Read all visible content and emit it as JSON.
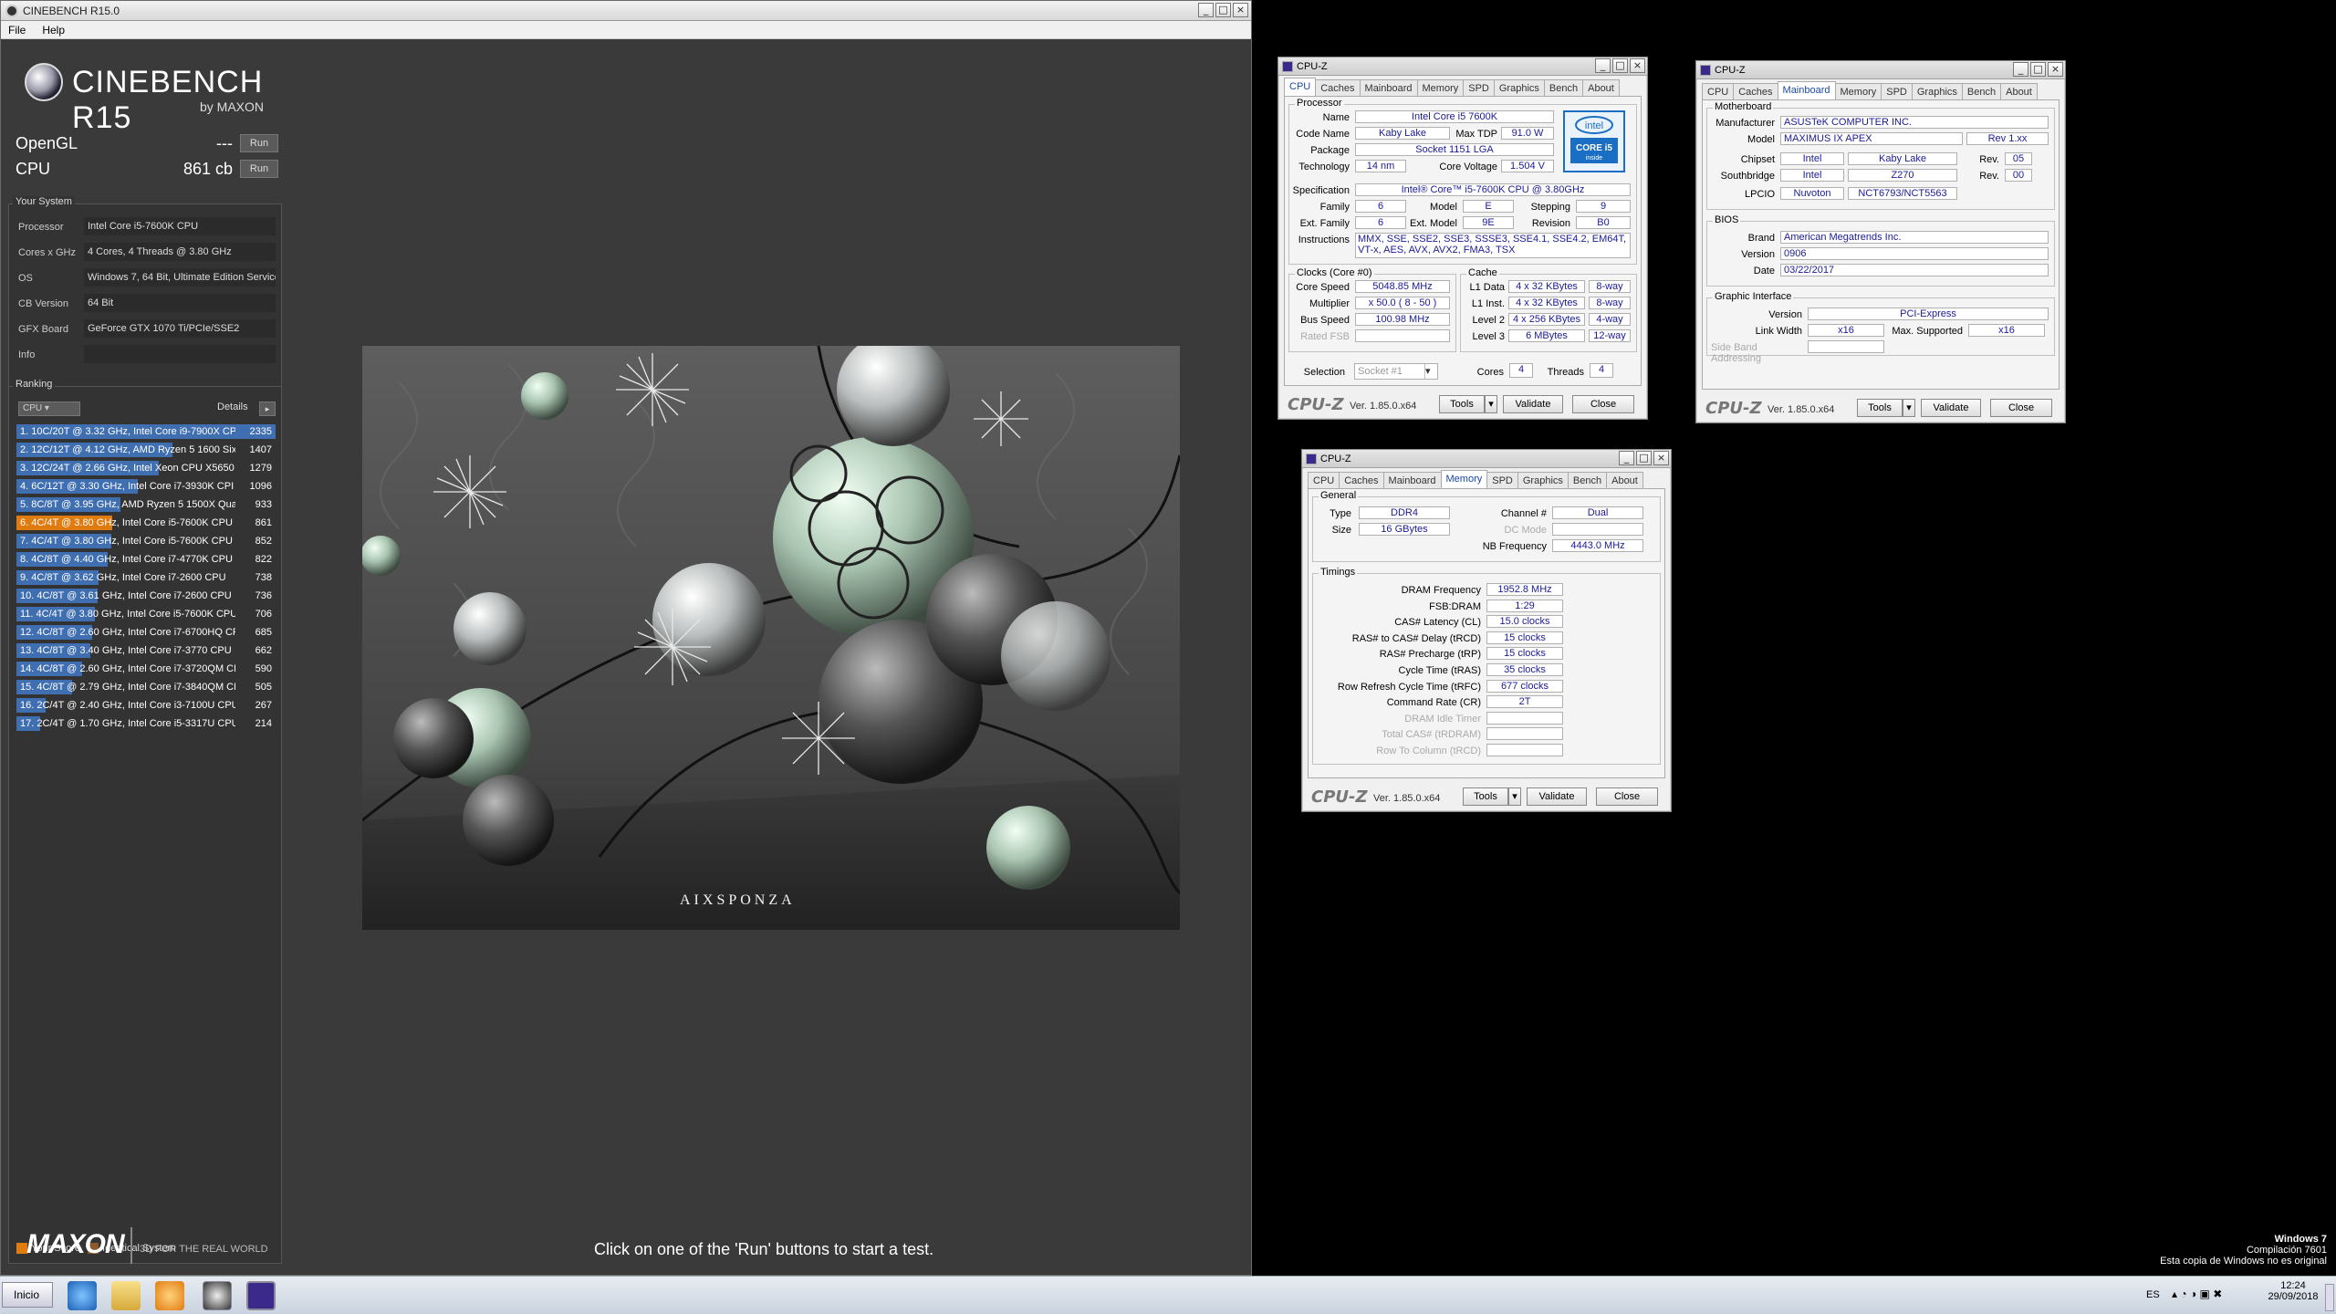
{
  "cinebench": {
    "window_title": "CINEBENCH R15.0",
    "menu": [
      "File",
      "Help"
    ],
    "logo": {
      "title": "CINEBENCH R15",
      "subtitle": "by MAXON"
    },
    "opengl": {
      "label": "OpenGL",
      "value": "---",
      "run": "Run"
    },
    "cpu": {
      "label": "CPU",
      "value": "861 cb",
      "run": "Run"
    },
    "your_system": {
      "title": "Your System",
      "rows": [
        {
          "key": "Processor",
          "value": "Intel Core i5-7600K CPU"
        },
        {
          "key": "Cores x GHz",
          "value": "4 Cores, 4 Threads @ 3.80 GHz"
        },
        {
          "key": "OS",
          "value": "Windows 7, 64 Bit, Ultimate Edition Service"
        },
        {
          "key": "CB Version",
          "value": "64 Bit"
        },
        {
          "key": "GFX Board",
          "value": "GeForce GTX 1070 Ti/PCIe/SSE2"
        },
        {
          "key": "Info",
          "value": ""
        }
      ]
    },
    "ranking": {
      "title": "Ranking",
      "selector": "CPU",
      "details": "Details",
      "rows": [
        {
          "text": "1. 10C/20T @ 3.32 GHz, Intel Core i9-7900X CP",
          "score": "2335",
          "bar": 1.0,
          "mine": false
        },
        {
          "text": "2. 12C/12T @ 4.12 GHz, AMD Ryzen 5 1600 Six",
          "score": "1407",
          "bar": 0.603,
          "mine": false
        },
        {
          "text": "3. 12C/24T @ 2.66 GHz, Intel Xeon CPU X5650",
          "score": "1279",
          "bar": 0.548,
          "mine": false
        },
        {
          "text": "4. 6C/12T @ 3.30 GHz, Intel Core i7-3930K CPI",
          "score": "1096",
          "bar": 0.469,
          "mine": false
        },
        {
          "text": "5. 8C/8T @ 3.95 GHz, AMD Ryzen 5 1500X Quad",
          "score": "933",
          "bar": 0.4,
          "mine": false
        },
        {
          "text": "6. 4C/4T @ 3.80 GHz, Intel Core i5-7600K CPU",
          "score": "861",
          "bar": 0.369,
          "mine": true
        },
        {
          "text": "7. 4C/4T @ 3.80 GHz, Intel Core i5-7600K CPU",
          "score": "852",
          "bar": 0.365,
          "mine": false
        },
        {
          "text": "8. 4C/8T @ 4.40 GHz, Intel Core i7-4770K CPU",
          "score": "822",
          "bar": 0.352,
          "mine": false
        },
        {
          "text": "9. 4C/8T @ 3.62 GHz, Intel Core i7-2600 CPU",
          "score": "738",
          "bar": 0.316,
          "mine": false
        },
        {
          "text": "10. 4C/8T @ 3.61 GHz, Intel Core i7-2600 CPU",
          "score": "736",
          "bar": 0.315,
          "mine": false
        },
        {
          "text": "11. 4C/4T @ 3.80 GHz, Intel Core i5-7600K CPU",
          "score": "706",
          "bar": 0.302,
          "mine": false
        },
        {
          "text": "12. 4C/8T @ 2.60 GHz, Intel Core i7-6700HQ CPI",
          "score": "685",
          "bar": 0.293,
          "mine": false
        },
        {
          "text": "13. 4C/8T @ 3.40 GHz, Intel Core i7-3770 CPU",
          "score": "662",
          "bar": 0.284,
          "mine": false
        },
        {
          "text": "14. 4C/8T @ 2.60 GHz, Intel Core i7-3720QM CPI",
          "score": "590",
          "bar": 0.253,
          "mine": false
        },
        {
          "text": "15. 4C/8T @ 2.79 GHz, Intel Core i7-3840QM CF",
          "score": "505",
          "bar": 0.216,
          "mine": false
        },
        {
          "text": "16. 2C/4T @ 2.40 GHz, Intel Core i3-7100U CPU",
          "score": "267",
          "bar": 0.114,
          "mine": false
        },
        {
          "text": "17. 2C/4T @ 1.70 GHz, Intel Core i5-3317U CPU",
          "score": "214",
          "bar": 0.092,
          "mine": false
        }
      ]
    },
    "legend": {
      "your_score": "Your Score",
      "identical": "Identical System"
    },
    "footer": {
      "brand": "MAXON",
      "tagline": "3D FOR THE REAL WORLD"
    },
    "render_watermark": "AIXSPONZA",
    "message": "Click on one of the 'Run' buttons to start a test."
  },
  "cpuz1": {
    "title": "CPU-Z",
    "tabs": [
      "CPU",
      "Caches",
      "Mainboard",
      "Memory",
      "SPD",
      "Graphics",
      "Bench",
      "About"
    ],
    "active_tab": "CPU",
    "processor_title": "Processor",
    "name_l": "Name",
    "name": "Intel Core i5 7600K",
    "codename_l": "Code Name",
    "codename": "Kaby Lake",
    "maxtdp_l": "Max TDP",
    "maxtdp": "91.0 W",
    "package_l": "Package",
    "package": "Socket 1151 LGA",
    "tech_l": "Technology",
    "tech": "14 nm",
    "voltage_l": "Core Voltage",
    "voltage": "1.504 V",
    "spec_l": "Specification",
    "spec": "Intel® Core™ i5-7600K CPU @ 3.80GHz",
    "family_l": "Family",
    "family": "6",
    "model_l": "Model",
    "model": "E",
    "stepping_l": "Stepping",
    "stepping": "9",
    "extfamily_l": "Ext. Family",
    "extfamily": "6",
    "extmodel_l": "Ext. Model",
    "extmodel": "9E",
    "revision_l": "Revision",
    "revision": "B0",
    "instr_l": "Instructions",
    "instr": "MMX, SSE, SSE2, SSE3, SSSE3, SSE4.1, SSE4.2, EM64T, VT-x, AES, AVX, AVX2, FMA3, TSX",
    "clocks_title": "Clocks (Core #0)",
    "corespeed_l": "Core Speed",
    "corespeed": "5048.85 MHz",
    "mult_l": "Multiplier",
    "mult": "x 50.0 ( 8 - 50 )",
    "bus_l": "Bus Speed",
    "bus": "100.98 MHz",
    "fsb_l": "Rated FSB",
    "fsb": "",
    "cache_title": "Cache",
    "l1d_l": "L1 Data",
    "l1d": "4 x 32 KBytes",
    "l1d_w": "8-way",
    "l1i_l": "L1 Inst.",
    "l1i": "4 x 32 KBytes",
    "l1i_w": "8-way",
    "l2_l": "Level 2",
    "l2": "4 x 256 KBytes",
    "l2_w": "4-way",
    "l3_l": "Level 3",
    "l3": "6 MBytes",
    "l3_w": "12-way",
    "sel_l": "Selection",
    "sel": "Socket #1",
    "cores_l": "Cores",
    "cores": "4",
    "threads_l": "Threads",
    "threads": "4",
    "intel_logo": {
      "brand": "intel",
      "line1": "CORE i5",
      "line2": "inside"
    },
    "logo": "CPU-Z",
    "ver": "Ver. 1.85.0.x64",
    "tools": "Tools",
    "validate": "Validate",
    "close": "Close"
  },
  "cpuz2": {
    "title": "CPU-Z",
    "tabs": [
      "CPU",
      "Caches",
      "Mainboard",
      "Memory",
      "SPD",
      "Graphics",
      "Bench",
      "About"
    ],
    "active_tab": "Mainboard",
    "mb_title": "Motherboard",
    "manu_l": "Manufacturer",
    "manu": "ASUSTeK COMPUTER INC.",
    "model_l": "Model",
    "model": "MAXIMUS IX APEX",
    "model_rev": "Rev 1.xx",
    "chipset_l": "Chipset",
    "chipset": "Intel",
    "chipset_n": "Kaby Lake",
    "rev_l": "Rev.",
    "chipset_rev": "05",
    "south_l": "Southbridge",
    "south": "Intel",
    "south_n": "Z270",
    "south_rev": "00",
    "lpcio_l": "LPCIO",
    "lpcio": "Nuvoton",
    "lpcio_n": "NCT6793/NCT5563",
    "bios_title": "BIOS",
    "brand_l": "Brand",
    "brand": "American Megatrends Inc.",
    "version_l": "Version",
    "version": "0906",
    "date_l": "Date",
    "date": "03/22/2017",
    "gi_title": "Graphic Interface",
    "giver_l": "Version",
    "giver": "PCI-Express",
    "lw_l": "Link Width",
    "lw": "x16",
    "ms_l": "Max. Supported",
    "ms": "x16",
    "sba_l": "Side Band Addressing",
    "logo": "CPU-Z",
    "ver": "Ver. 1.85.0.x64",
    "tools": "Tools",
    "validate": "Validate",
    "close": "Close"
  },
  "cpuz3": {
    "title": "CPU-Z",
    "tabs": [
      "CPU",
      "Caches",
      "Mainboard",
      "Memory",
      "SPD",
      "Graphics",
      "Bench",
      "About"
    ],
    "active_tab": "Memory",
    "gen_title": "General",
    "type_l": "Type",
    "type": "DDR4",
    "size_l": "Size",
    "size": "16 GBytes",
    "ch_l": "Channel #",
    "ch": "Dual",
    "dc_l": "DC Mode",
    "dc": "",
    "nb_l": "NB Frequency",
    "nb": "4443.0 MHz",
    "tim_title": "Timings",
    "timings": [
      {
        "k": "DRAM Frequency",
        "v": "1952.8 MHz",
        "dis": false
      },
      {
        "k": "FSB:DRAM",
        "v": "1:29",
        "dis": false
      },
      {
        "k": "CAS# Latency (CL)",
        "v": "15.0 clocks",
        "dis": false
      },
      {
        "k": "RAS# to CAS# Delay (tRCD)",
        "v": "15 clocks",
        "dis": false
      },
      {
        "k": "RAS# Precharge (tRP)",
        "v": "15 clocks",
        "dis": false
      },
      {
        "k": "Cycle Time (tRAS)",
        "v": "35 clocks",
        "dis": false
      },
      {
        "k": "Row Refresh Cycle Time (tRFC)",
        "v": "677 clocks",
        "dis": false
      },
      {
        "k": "Command Rate (CR)",
        "v": "2T",
        "dis": false
      },
      {
        "k": "DRAM Idle Timer",
        "v": "",
        "dis": true
      },
      {
        "k": "Total CAS# (tRDRAM)",
        "v": "",
        "dis": true
      },
      {
        "k": "Row To Column (tRCD)",
        "v": "",
        "dis": true
      }
    ],
    "logo": "CPU-Z",
    "ver": "Ver. 1.85.0.x64",
    "tools": "Tools",
    "validate": "Validate",
    "close": "Close"
  },
  "desktop": {
    "watermark": [
      "Windows 7",
      "Compilación 7601",
      "Esta copia de Windows no es original"
    ]
  },
  "taskbar": {
    "start": "Inicio",
    "lang": "ES",
    "time": "12:24",
    "date": "29/09/2018"
  }
}
